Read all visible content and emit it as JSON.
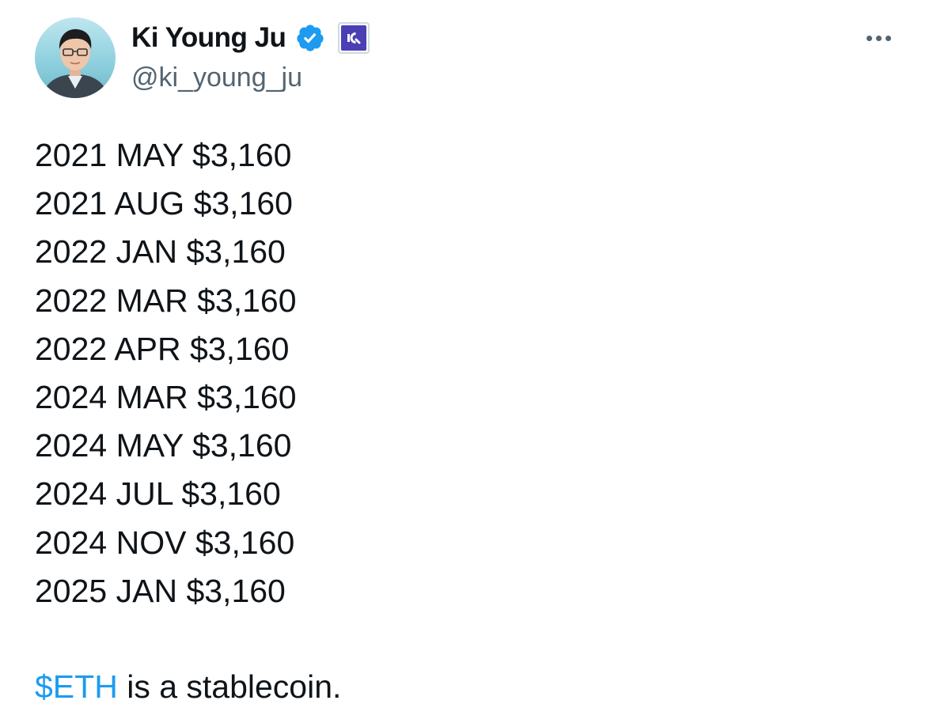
{
  "author": {
    "display_name": "Ki Young Ju",
    "handle": "@ki_young_ju",
    "verified_icon": "verified-badge-icon",
    "affiliate_icon": "cryptoquant-affiliate-badge",
    "avatar": "profile-photo"
  },
  "menu": {
    "more_icon": "more-horizontal-icon"
  },
  "tweet": {
    "lines": [
      "2021 MAY $3,160",
      "2021 AUG $3,160",
      "2022 JAN $3,160",
      "2022 MAR $3,160",
      "2022 APR $3,160",
      "2024 MAR $3,160",
      "2024 MAY $3,160",
      "2024 JUL $3,160",
      "2024 NOV $3,160",
      "2025 JAN $3,160"
    ],
    "cashtag": "$ETH",
    "closing_text": " is a stablecoin."
  },
  "colors": {
    "text": "#0f1419",
    "secondary": "#536471",
    "link": "#1d9bf0",
    "verified": "#1d9bf0",
    "affiliate": "#4b3fb4"
  }
}
